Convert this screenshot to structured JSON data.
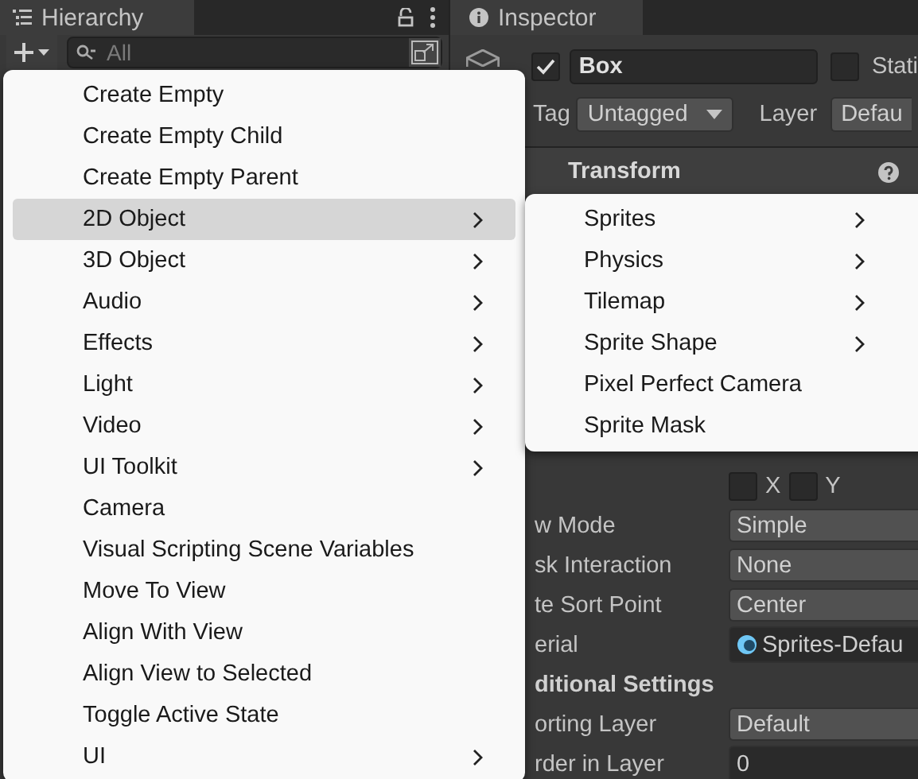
{
  "hierarchy": {
    "title": "Hierarchy",
    "search": {
      "placeholder": "All"
    }
  },
  "inspector": {
    "title": "Inspector",
    "object": {
      "active": true,
      "name": "Box",
      "static": false,
      "static_label": "Stati"
    },
    "tag_label": "Tag",
    "tag": "Untagged",
    "layer_label": "Layer",
    "layer": "Defau",
    "component": "Transform",
    "flip": [
      {
        "label": "X",
        "checked": false
      },
      {
        "label": "Y",
        "checked": false
      }
    ],
    "properties": [
      {
        "kind": "dropdown",
        "label": "w Mode",
        "value": "Simple"
      },
      {
        "kind": "dropdown",
        "label": "sk Interaction",
        "value": "None"
      },
      {
        "kind": "dropdown",
        "label": "te Sort Point",
        "value": "Center"
      },
      {
        "kind": "object",
        "label": "erial",
        "value": "Sprites-Defau"
      },
      {
        "kind": "header",
        "label": "ditional Settings"
      },
      {
        "kind": "dropdown",
        "label": "orting Layer",
        "value": "Default"
      },
      {
        "kind": "number",
        "label": "rder in Layer",
        "value": "0"
      }
    ]
  },
  "menu": [
    {
      "label": "Create Empty",
      "submenu": false,
      "selected": false
    },
    {
      "label": "Create Empty Child",
      "submenu": false,
      "selected": false
    },
    {
      "label": "Create Empty Parent",
      "submenu": false,
      "selected": false
    },
    {
      "label": "2D Object",
      "submenu": true,
      "selected": true
    },
    {
      "label": "3D Object",
      "submenu": true,
      "selected": false
    },
    {
      "label": "Audio",
      "submenu": true,
      "selected": false
    },
    {
      "label": "Effects",
      "submenu": true,
      "selected": false
    },
    {
      "label": "Light",
      "submenu": true,
      "selected": false
    },
    {
      "label": "Video",
      "submenu": true,
      "selected": false
    },
    {
      "label": "UI Toolkit",
      "submenu": true,
      "selected": false
    },
    {
      "label": "Camera",
      "submenu": false,
      "selected": false
    },
    {
      "label": "Visual Scripting Scene Variables",
      "submenu": false,
      "selected": false
    },
    {
      "label": "Move To View",
      "submenu": false,
      "selected": false
    },
    {
      "label": "Align With View",
      "submenu": false,
      "selected": false
    },
    {
      "label": "Align View to Selected",
      "submenu": false,
      "selected": false
    },
    {
      "label": "Toggle Active State",
      "submenu": false,
      "selected": false
    },
    {
      "label": "UI",
      "submenu": true,
      "selected": false
    }
  ],
  "submenu": [
    {
      "label": "Sprites",
      "submenu": true
    },
    {
      "label": "Physics",
      "submenu": true
    },
    {
      "label": "Tilemap",
      "submenu": true
    },
    {
      "label": "Sprite Shape",
      "submenu": true
    },
    {
      "label": "Pixel Perfect Camera",
      "submenu": false
    },
    {
      "label": "Sprite Mask",
      "submenu": false
    }
  ]
}
